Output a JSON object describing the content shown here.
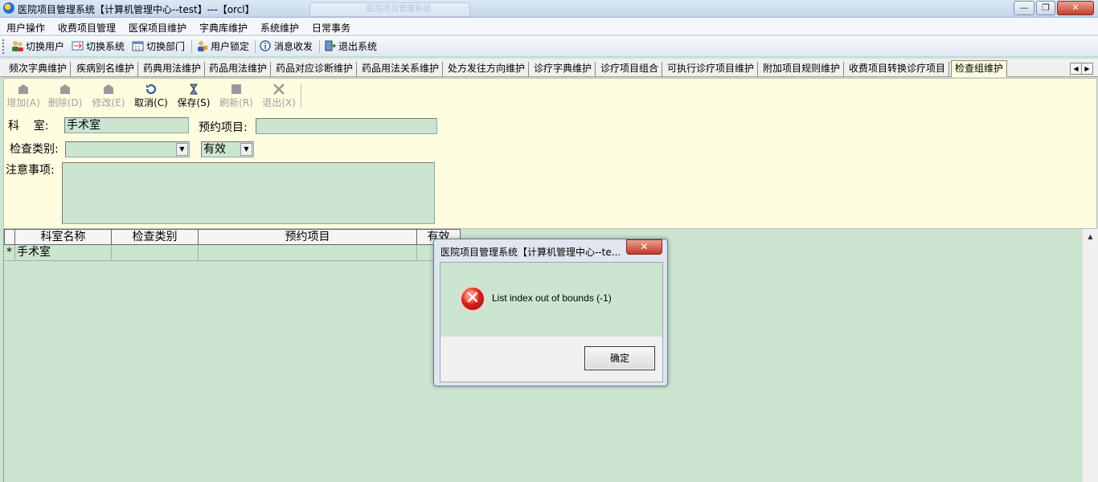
{
  "window": {
    "title": "医院项目管理系统【计算机管理中心--test】---【orcl】",
    "ghost_tab": "医院项目管理系统",
    "minimize": "—",
    "maximize": "❐",
    "close": "✕"
  },
  "menu": [
    "用户操作",
    "收费项目管理",
    "医保项目维护",
    "字典库维护",
    "系统维护",
    "日常事务"
  ],
  "toolbar": [
    "切换用户",
    "切换系统",
    "切换部门",
    "用户锁定",
    "消息收发",
    "退出系统"
  ],
  "tabs": [
    "频次字典维护",
    "疾病别名维护",
    "药典用法维护",
    "药品用法维护",
    "药品对应诊断维护",
    "药品用法关系维护",
    "处方发往方向维护",
    "诊疗字典维护",
    "诊疗项目组合",
    "可执行诊疗项目维护",
    "附加项目规则维护",
    "收费项目转换诊疗项目",
    "检查组维护"
  ],
  "active_tab": "检查组维护",
  "tab_arrows": [
    "◀",
    "▶"
  ],
  "form_toolbar": [
    {
      "label": "增加(A)",
      "enabled": false
    },
    {
      "label": "删除(D)",
      "enabled": false
    },
    {
      "label": "修改(E)",
      "enabled": false
    },
    {
      "label": "取消(C)",
      "enabled": true
    },
    {
      "label": "保存(S)",
      "enabled": true
    },
    {
      "label": "刷新(R)",
      "enabled": false
    },
    {
      "label": "退出(X)",
      "enabled": false
    }
  ],
  "form": {
    "dept_label": "科    室:",
    "dept_value": "手术室",
    "appt_label": "预约项目:",
    "appt_value": "",
    "category_label": "检查类别:",
    "category_value": "",
    "status_value": "有效",
    "notes_label": "注意事项:",
    "notes_value": ""
  },
  "grid": {
    "headers": [
      "科室名称",
      "检查类别",
      "预约项目",
      "有效"
    ],
    "row_marker": "*",
    "rows": [
      [
        "手术室",
        "",
        "",
        ""
      ]
    ]
  },
  "dialog": {
    "title": "医院项目管理系统【计算机管理中心--te...",
    "close": "✕",
    "message": "List index out of bounds (-1)",
    "ok": "确定",
    "icon": "error-icon"
  }
}
